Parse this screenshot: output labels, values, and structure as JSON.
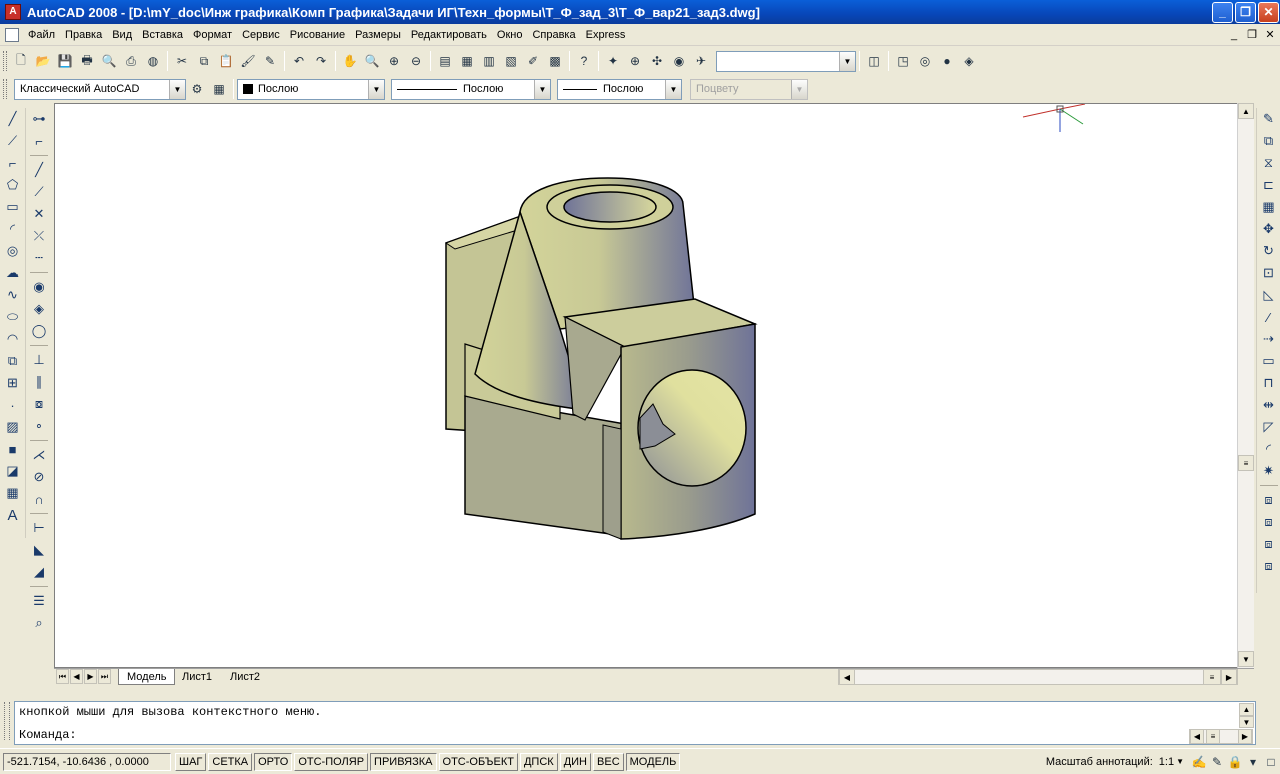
{
  "window": {
    "title": "AutoCAD 2008 - [D:\\mY_doc\\Инж графика\\Комп Графика\\Задачи ИГ\\Техн_формы\\Т_Ф_зад_3\\Т_Ф_вар21_зад3.dwg]",
    "app_icon": "A",
    "controls": {
      "minimize": "_",
      "restore": "❐",
      "close": "✕"
    }
  },
  "menu": {
    "items": [
      "Файл",
      "Правка",
      "Вид",
      "Вставка",
      "Формат",
      "Сервис",
      "Рисование",
      "Размеры",
      "Редактировать",
      "Окно",
      "Справка",
      "Express"
    ],
    "mdi_controls": {
      "minimize": "_",
      "restore": "❐",
      "close": "✕"
    }
  },
  "toolbar_standard": {
    "icons": [
      "new-icon",
      "open-icon",
      "save-icon",
      "plot-icon",
      "plot-preview-icon",
      "publish-icon",
      "3d-dwf-icon",
      "cut-icon",
      "copy-icon",
      "paste-icon",
      "match-properties-icon",
      "block-editor-icon",
      "undo-icon",
      "redo-icon",
      "pan-icon",
      "zoom-realtime-icon",
      "zoom-window-icon",
      "zoom-previous-icon",
      "properties-icon",
      "design-center-icon",
      "tool-palettes-icon",
      "sheet-set-icon",
      "markup-icon",
      "quickcalc-icon",
      "help-icon"
    ],
    "view_icons": [
      "named-views-icon",
      "zoom-icon",
      "orbit-icon",
      "walk-icon",
      "fly-icon"
    ],
    "view_combo_value": "",
    "visual_icons": [
      "ucs-icon",
      "box-icon",
      "wireframe-icon",
      "shade-icon",
      "render-icon"
    ]
  },
  "toolbar_properties": {
    "workspace": "Классический AutoCAD",
    "color": "Послою",
    "linetype": "Послою",
    "lineweight": "Послою",
    "plotstyle": "Поцвету"
  },
  "tabs": {
    "items": [
      "Модель",
      "Лист1",
      "Лист2"
    ],
    "active": "Модель"
  },
  "command": {
    "history": "кнопкой мыши для вызова контекстного меню.",
    "prompt": "Команда:"
  },
  "status": {
    "coordinates": "-521.7154, -10.6436 , 0.0000",
    "toggles": [
      "ШАГ",
      "СЕТКА",
      "ОРТО",
      "ОТС-ПОЛЯР",
      "ПРИВЯЗКА",
      "ОТС-ОБЪЕКТ",
      "ДПСК",
      "ДИН",
      "ВЕС",
      "МОДЕЛЬ"
    ],
    "toggles_on": [
      "ОРТО",
      "ПРИВЯЗКА",
      "МОДЕЛЬ"
    ],
    "annotation_scale_label": "Масштаб аннотаций:",
    "annotation_scale": "1:1"
  },
  "colors": {
    "title_bar": "#0a4fc8",
    "model_face_light": "#d3d49a",
    "model_face_dark": "#6f7398",
    "canvas": "#ffffff"
  }
}
